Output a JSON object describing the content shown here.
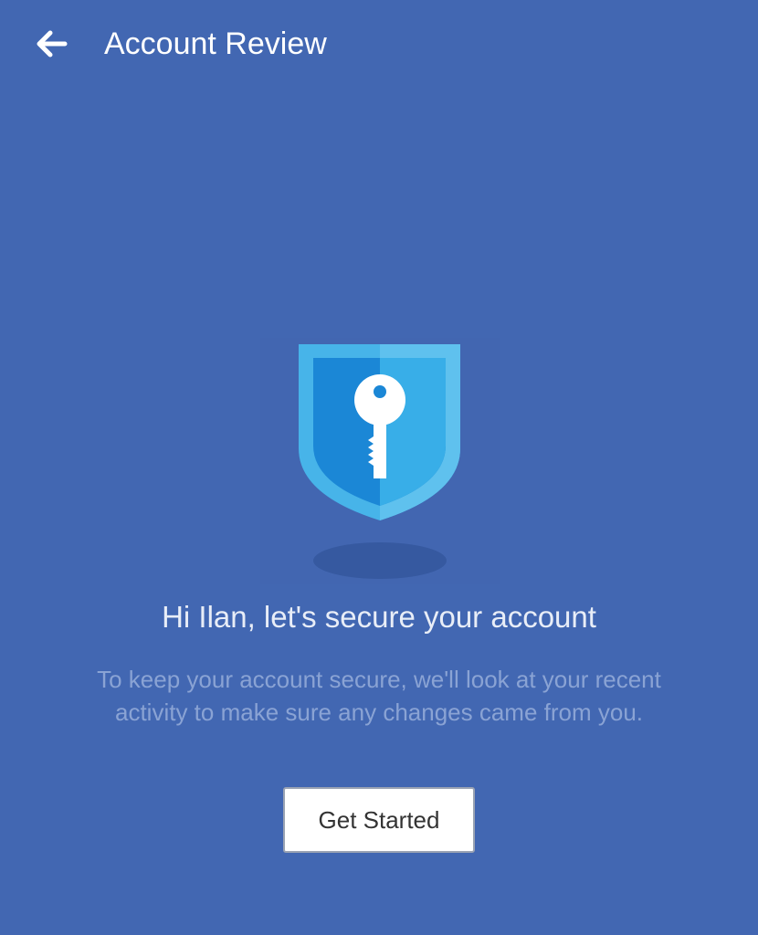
{
  "app_bar": {
    "back_icon": "arrow-left-icon",
    "title": "Account Review"
  },
  "illustration": {
    "icon": "shield-key-icon"
  },
  "content": {
    "headline": "Hi Ilan, let's secure your account",
    "body": "To keep your account secure, we'll look at your recent activity to make sure any changes came from you."
  },
  "actions": {
    "primary_label": "Get Started"
  },
  "colors": {
    "background": "#4267b2",
    "shield_light": "#47b4e9",
    "shield_dark": "#1b87d6",
    "button_bg": "#ffffff",
    "button_text": "#333333"
  }
}
